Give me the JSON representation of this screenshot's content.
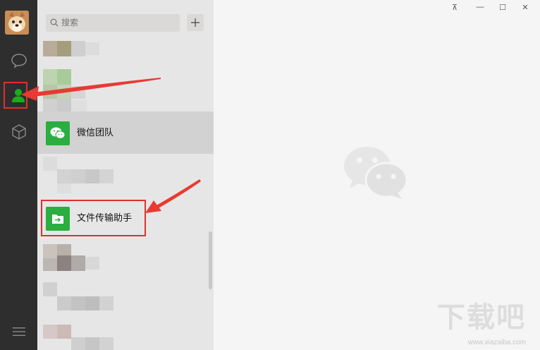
{
  "search": {
    "placeholder": "搜索"
  },
  "contacts": [
    {
      "label": "微信团队",
      "icon": "wechat-logo-icon",
      "selected": true
    },
    {
      "label": "文件传输助手",
      "icon": "file-transfer-icon",
      "selected": false
    }
  ],
  "window_controls": {
    "pin": "⊼",
    "minimize": "—",
    "maximize": "☐",
    "close": "✕"
  },
  "watermark": {
    "text": "下载吧",
    "url": "www.xiazaiba.com"
  },
  "colors": {
    "accent": "#2aae40",
    "highlight": "#e0302b",
    "nav_bg": "#2e2e2e"
  }
}
